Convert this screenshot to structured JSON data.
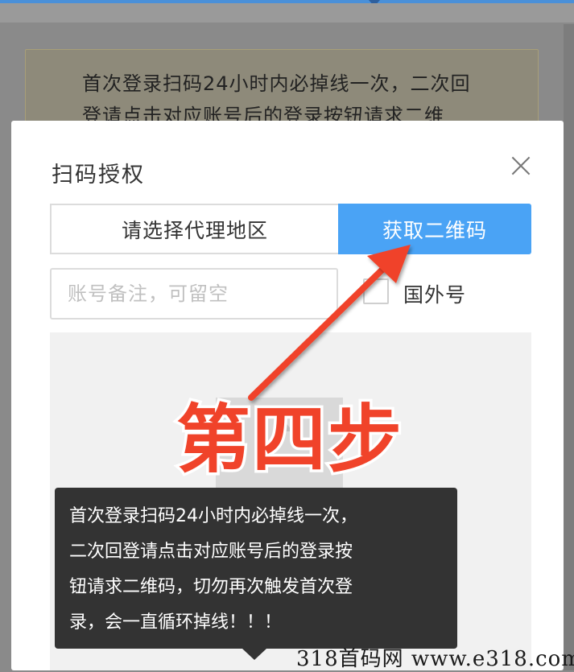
{
  "background": {
    "notice_line1": "首次登录扫码24小时内必掉线一次，二次回",
    "notice_line2": "登请点击对应账号后的登录按钮请求二维"
  },
  "dialog": {
    "title": "扫码授权",
    "region_button_label": "请选择代理地区",
    "qr_button_label": "获取二维码",
    "note_input_placeholder": "账号备注，可留空",
    "note_input_value": "",
    "foreign_checkbox_checked": false,
    "foreign_label": "国外号"
  },
  "annotation": {
    "step_text": "第四步",
    "color": "#f0432a"
  },
  "tooltip": {
    "lines": [
      "首次登录扫码24小时内必掉线一次，",
      "二次回登请点击对应账号后的登录按",
      "钮请求二维码，切勿再次触发首次登",
      "录，会一直循环掉线！！！"
    ]
  },
  "watermark": {
    "text": "318首码网 www.e318.com"
  },
  "colors": {
    "primary_button": "#4aa3f5",
    "overlay": "#8a8a8a",
    "tooltip_bg": "#333333"
  }
}
